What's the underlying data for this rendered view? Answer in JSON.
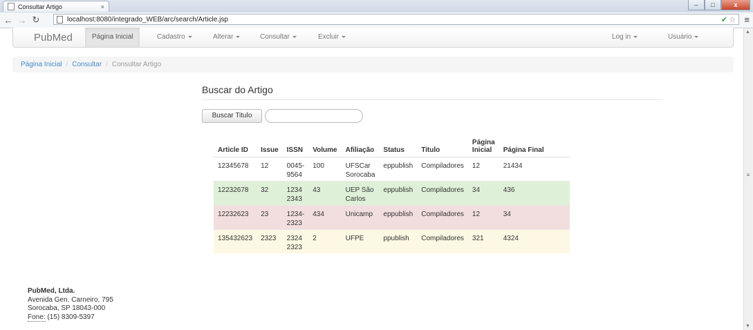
{
  "browser": {
    "tab_title": "Consultar Artigo",
    "tab_close": "×",
    "url": "localhost:8080/integrado_WEB/arc/search/Article.jsp",
    "win_min": "–",
    "win_max": "□",
    "win_close": "x"
  },
  "navbar": {
    "brand": "PubMed",
    "items": [
      {
        "label": "Página Inicial",
        "dropdown": false,
        "active": true
      },
      {
        "label": "Cadastro",
        "dropdown": true
      },
      {
        "label": "Alterar",
        "dropdown": true
      },
      {
        "label": "Consultar",
        "dropdown": true
      },
      {
        "label": "Excluir",
        "dropdown": true
      }
    ],
    "right_items": [
      {
        "label": "Log in",
        "dropdown": true
      },
      {
        "label": "Usuário",
        "dropdown": true
      }
    ]
  },
  "breadcrumb": {
    "items": [
      "Página Inicial",
      "Consultar"
    ],
    "current": "Consultar Artigo",
    "separator": "/"
  },
  "page": {
    "title": "Buscar do Artigo",
    "search_button": "Buscar Titulo",
    "search_value": ""
  },
  "table": {
    "headers": [
      "Article ID",
      "Issue",
      "ISSN",
      "Volume",
      "Afiliação",
      "Status",
      "Titulo",
      "Página Inicial",
      "Página Final"
    ],
    "rows": [
      {
        "style": "white",
        "cells": [
          "12345678",
          "12",
          "0045-9564",
          "100",
          "UFSCar Sorocaba",
          "eppublish",
          "Compiladores",
          "12",
          "21434"
        ]
      },
      {
        "style": "success",
        "cells": [
          "12232678",
          "32",
          "1234 2343",
          "43",
          "UEP São Carlos",
          "eppublish",
          "Compiladores",
          "34",
          "436"
        ]
      },
      {
        "style": "danger",
        "cells": [
          "12232623",
          "23",
          "1234-2323",
          "434",
          "Unicamp",
          "eppublish",
          "Compiladores",
          "12",
          "34"
        ]
      },
      {
        "style": "warning",
        "cells": [
          "135432623",
          "2323",
          "2324 2323",
          "2",
          "UFPE",
          "ppublish",
          "Compiladores",
          "321",
          "4324"
        ]
      }
    ]
  },
  "footer": {
    "company": "PubMed, Ltda.",
    "address1": "Avenida Gen. Carneiro, 795",
    "address2": "Sorocaba, SP 18043-000",
    "phone_label": "Fone:",
    "phone": "(15) 8309-5397"
  },
  "colors": {
    "success": "#dff0d8",
    "danger": "#f2dede",
    "warning": "#fcf8e3",
    "link": "#428bca"
  }
}
